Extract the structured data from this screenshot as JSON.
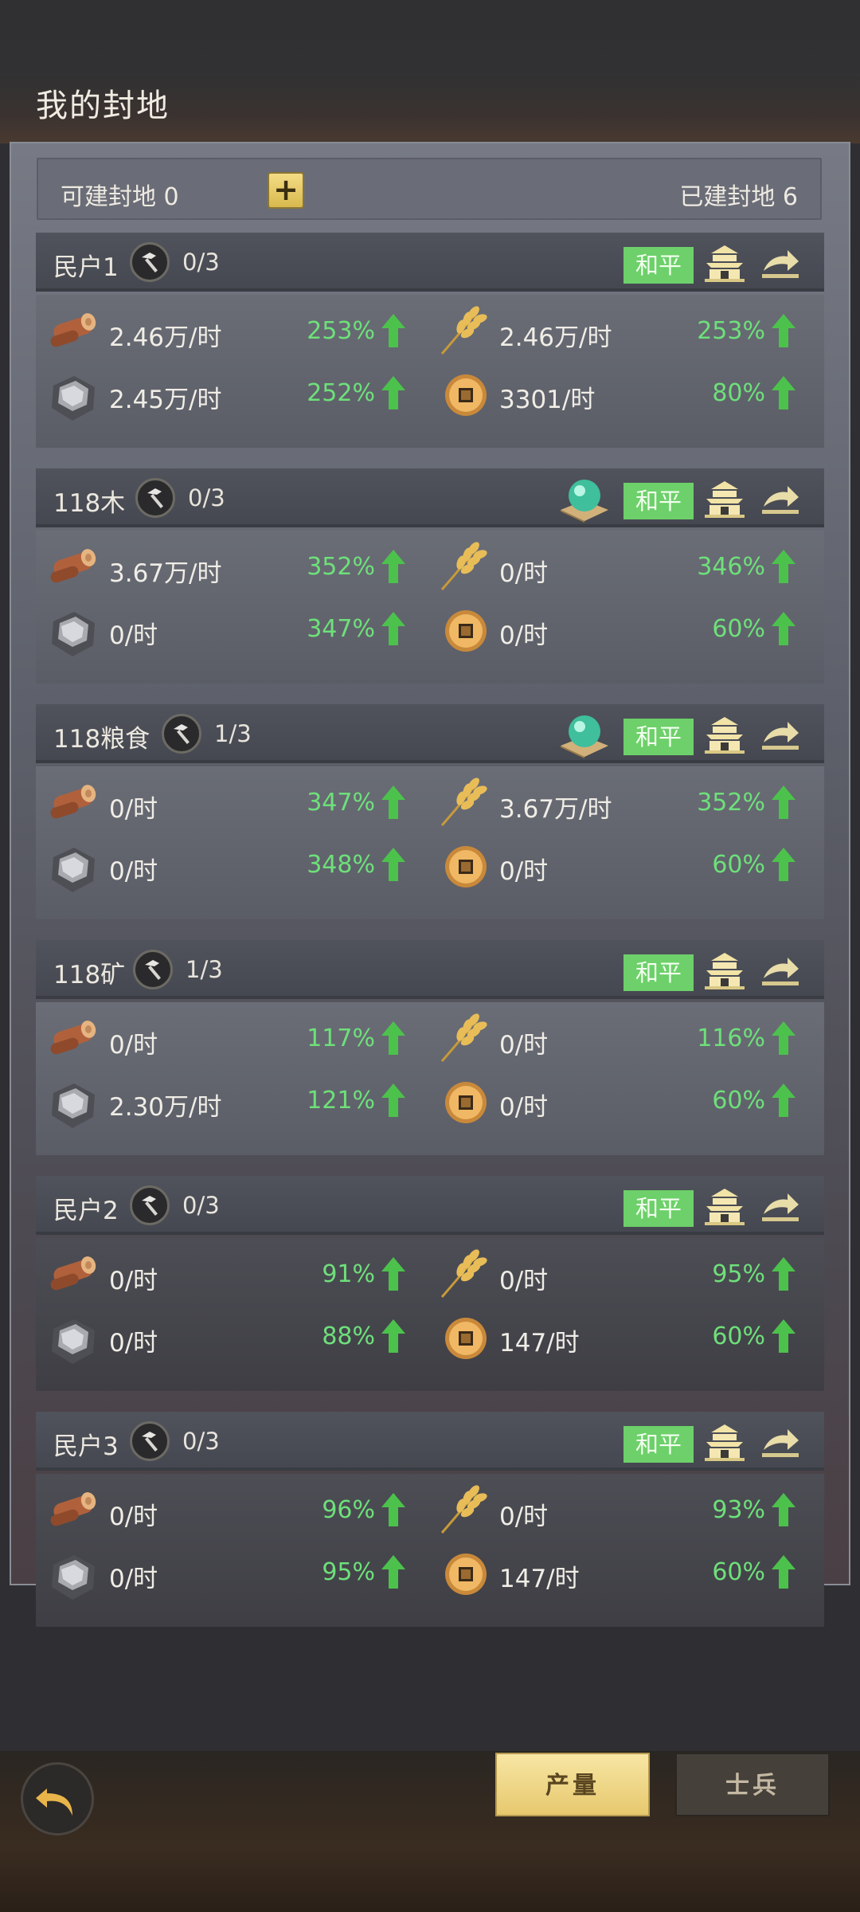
{
  "header": {
    "title": "我的封地"
  },
  "summary": {
    "buildable": "可建封地 0",
    "built": "已建封地 6",
    "plus": "+"
  },
  "status_label": "和平",
  "fiefs": [
    {
      "name": "民户1",
      "slots": "0/3",
      "wood": "2.46万/时",
      "wood_pct": "253%",
      "grain": "2.46万/时",
      "grain_pct": "253%",
      "iron": "2.45万/时",
      "iron_pct": "252%",
      "coin": "3301/时",
      "coin_pct": "80%"
    },
    {
      "name": "118木",
      "slots": "0/3",
      "wood": "3.67万/时",
      "wood_pct": "352%",
      "grain": "0/时",
      "grain_pct": "346%",
      "iron": "0/时",
      "iron_pct": "347%",
      "coin": "0/时",
      "coin_pct": "60%"
    },
    {
      "name": "118粮食",
      "slots": "1/3",
      "wood": "0/时",
      "wood_pct": "347%",
      "grain": "3.67万/时",
      "grain_pct": "352%",
      "iron": "0/时",
      "iron_pct": "348%",
      "coin": "0/时",
      "coin_pct": "60%"
    },
    {
      "name": "118矿",
      "slots": "1/3",
      "wood": "0/时",
      "wood_pct": "117%",
      "grain": "0/时",
      "grain_pct": "116%",
      "iron": "2.30万/时",
      "iron_pct": "121%",
      "coin": "0/时",
      "coin_pct": "60%"
    },
    {
      "name": "民户2",
      "slots": "0/3",
      "wood": "0/时",
      "wood_pct": "91%",
      "grain": "0/时",
      "grain_pct": "95%",
      "iron": "0/时",
      "iron_pct": "88%",
      "coin": "147/时",
      "coin_pct": "60%"
    },
    {
      "name": "民户3",
      "slots": "0/3",
      "wood": "0/时",
      "wood_pct": "96%",
      "grain": "0/时",
      "grain_pct": "93%",
      "iron": "0/时",
      "iron_pct": "95%",
      "coin": "147/时",
      "coin_pct": "60%"
    }
  ],
  "tabs": {
    "production": "产量",
    "soldiers": "士兵"
  },
  "colors": {
    "peace": "#6dd06a",
    "up": "#4cc24c",
    "accent": "#e9cc70"
  }
}
